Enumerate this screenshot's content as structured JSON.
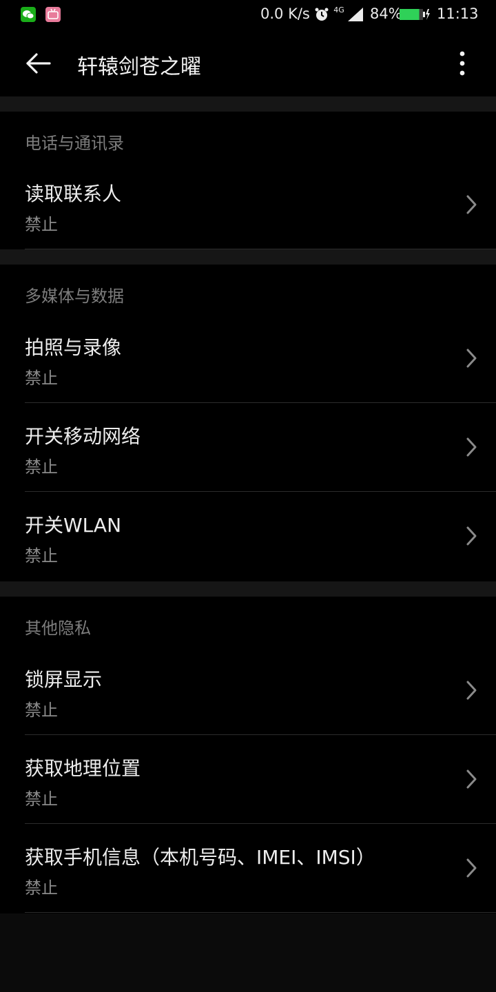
{
  "status_bar": {
    "speed": "0.0 K/s",
    "network": "4G",
    "battery": "84%",
    "battery_level": 0.84,
    "time": "11:13",
    "icons": [
      "wechat-icon",
      "bilibili-icon",
      "alarm-icon",
      "signal-icon",
      "battery-icon"
    ]
  },
  "header": {
    "title": "轩辕剑苍之曜"
  },
  "sections": [
    {
      "header": "电话与通讯录",
      "items": [
        {
          "title": "读取联系人",
          "status": "禁止"
        }
      ]
    },
    {
      "header": "多媒体与数据",
      "items": [
        {
          "title": "拍照与录像",
          "status": "禁止"
        },
        {
          "title": "开关移动网络",
          "status": "禁止"
        },
        {
          "title": "开关WLAN",
          "status": "禁止"
        }
      ]
    },
    {
      "header": "其他隐私",
      "items": [
        {
          "title": "锁屏显示",
          "status": "禁止"
        },
        {
          "title": "获取地理位置",
          "status": "禁止"
        },
        {
          "title": "获取手机信息（本机号码、IMEI、IMSI）",
          "status": "禁止"
        }
      ]
    }
  ],
  "colors": {
    "background": "#0b0b0b",
    "surface": "#000000",
    "battery_fill": "#2fd158"
  }
}
